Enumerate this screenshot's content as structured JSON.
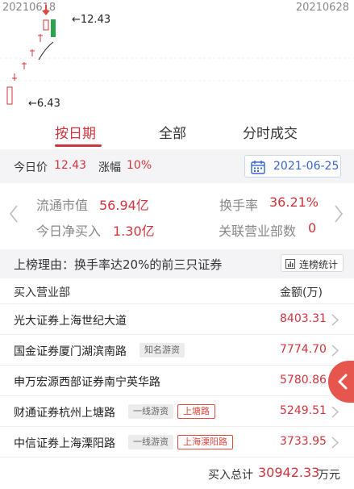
{
  "chart": {
    "start_date": "20210618",
    "end_date": "20210628",
    "high_label": "←12.43",
    "low_label": "←6.43",
    "up_color": "#d0343c",
    "down_color": "#2aa34a"
  },
  "tabs": [
    {
      "label": "按日期",
      "active": true
    },
    {
      "label": "全部",
      "active": false
    },
    {
      "label": "分时成交",
      "active": false
    }
  ],
  "price_bar": {
    "price_label": "今日价",
    "price_value": "12.43",
    "change_label": "涨幅",
    "change_value": "10%",
    "date": "2021-06-25",
    "date_icon": "calendar-icon"
  },
  "stats": {
    "float_cap_label": "流通市值",
    "float_cap_value": "56.94亿",
    "turnover_label": "换手率",
    "turnover_value": "36.21%",
    "net_buy_label": "今日净买入",
    "net_buy_value": "1.30亿",
    "related_label": "关联营业部数",
    "related_value": "0"
  },
  "reason": {
    "text": "上榜理由：换手率达20%的前三只证券",
    "stats_button": "连榜统计"
  },
  "table": {
    "header_name": "买入营业部",
    "header_amount": "金额(万)",
    "rows": [
      {
        "name": "光大证券上海世纪大道",
        "tags": [],
        "amount": "8403.31"
      },
      {
        "name": "国金证券厦门湖滨南路",
        "tags": [
          {
            "text": "知名游资",
            "style": "grey"
          }
        ],
        "amount": "7774.70"
      },
      {
        "name": "申万宏源西部证券南宁英华路",
        "tags": [],
        "amount": "5780.86"
      },
      {
        "name": "财通证券杭州上塘路",
        "tags": [
          {
            "text": "一线游资",
            "style": "grey"
          },
          {
            "text": "上塘路",
            "style": "red"
          }
        ],
        "amount": "5249.51"
      },
      {
        "name": "中信证券上海溧阳路",
        "tags": [
          {
            "text": "一线游资",
            "style": "grey"
          },
          {
            "text": "上海溧阳路",
            "style": "red"
          }
        ],
        "amount": "3733.95"
      }
    ]
  },
  "total": {
    "label": "买入总计",
    "value": "30942.33",
    "unit": "万元"
  }
}
